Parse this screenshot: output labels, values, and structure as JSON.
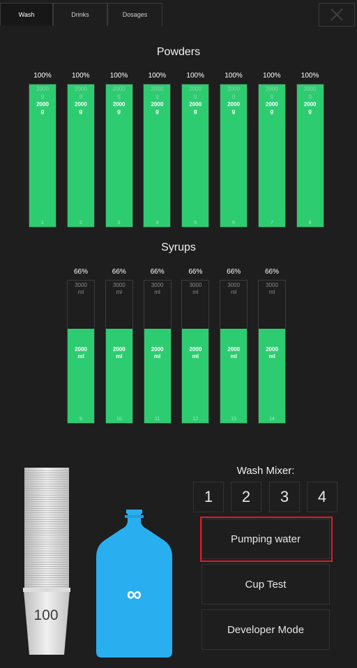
{
  "tabs": [
    {
      "label": "Wash"
    },
    {
      "label": "Drinks"
    },
    {
      "label": "Dosages"
    }
  ],
  "powders": {
    "title": "Powders",
    "tanks": [
      {
        "percent": "100%",
        "capacity": "2000",
        "capacity_unit": "g",
        "current": "2000",
        "unit": "g",
        "number": "1",
        "fill": 1.0
      },
      {
        "percent": "100%",
        "capacity": "2000",
        "capacity_unit": "g",
        "current": "2000",
        "unit": "g",
        "number": "2",
        "fill": 1.0
      },
      {
        "percent": "100%",
        "capacity": "2000",
        "capacity_unit": "g",
        "current": "2000",
        "unit": "g",
        "number": "3",
        "fill": 1.0
      },
      {
        "percent": "100%",
        "capacity": "2000",
        "capacity_unit": "g",
        "current": "2000",
        "unit": "g",
        "number": "4",
        "fill": 1.0
      },
      {
        "percent": "100%",
        "capacity": "2000",
        "capacity_unit": "g",
        "current": "2000",
        "unit": "g",
        "number": "5",
        "fill": 1.0
      },
      {
        "percent": "100%",
        "capacity": "2000",
        "capacity_unit": "g",
        "current": "2000",
        "unit": "g",
        "number": "6",
        "fill": 1.0
      },
      {
        "percent": "100%",
        "capacity": "2000",
        "capacity_unit": "g",
        "current": "2000",
        "unit": "g",
        "number": "7",
        "fill": 1.0
      },
      {
        "percent": "100%",
        "capacity": "2000",
        "capacity_unit": "g",
        "current": "2000",
        "unit": "g",
        "number": "8",
        "fill": 1.0
      }
    ]
  },
  "syrups": {
    "title": "Syrups",
    "tanks": [
      {
        "percent": "66%",
        "capacity": "3000",
        "capacity_unit": "ml",
        "current": "2000",
        "unit": "ml",
        "number": "9",
        "fill": 0.66
      },
      {
        "percent": "66%",
        "capacity": "3000",
        "capacity_unit": "ml",
        "current": "2000",
        "unit": "ml",
        "number": "10",
        "fill": 0.66
      },
      {
        "percent": "66%",
        "capacity": "3000",
        "capacity_unit": "ml",
        "current": "2000",
        "unit": "ml",
        "number": "11",
        "fill": 0.66
      },
      {
        "percent": "66%",
        "capacity": "3000",
        "capacity_unit": "ml",
        "current": "2000",
        "unit": "ml",
        "number": "12",
        "fill": 0.66
      },
      {
        "percent": "66%",
        "capacity": "3000",
        "capacity_unit": "ml",
        "current": "2000",
        "unit": "ml",
        "number": "13",
        "fill": 0.66
      },
      {
        "percent": "66%",
        "capacity": "3000",
        "capacity_unit": "ml",
        "current": "2000",
        "unit": "ml",
        "number": "14",
        "fill": 0.66
      }
    ]
  },
  "cups": {
    "count": "100"
  },
  "water": {
    "level": "∞"
  },
  "wash_mixer": {
    "title": "Wash Mixer:",
    "buttons": [
      "1",
      "2",
      "3",
      "4"
    ]
  },
  "actions": {
    "pumping_water": "Pumping water",
    "cup_test": "Cup Test",
    "developer_mode": "Developer Mode"
  },
  "colors": {
    "background": "#1e1e1e",
    "tank_fill": "#2ecc71",
    "bottle": "#29aff0",
    "highlight": "#e01b24"
  },
  "icons": {
    "close": "close-icon",
    "cups": "cup-stack-icon",
    "bottle": "water-bottle-icon"
  }
}
